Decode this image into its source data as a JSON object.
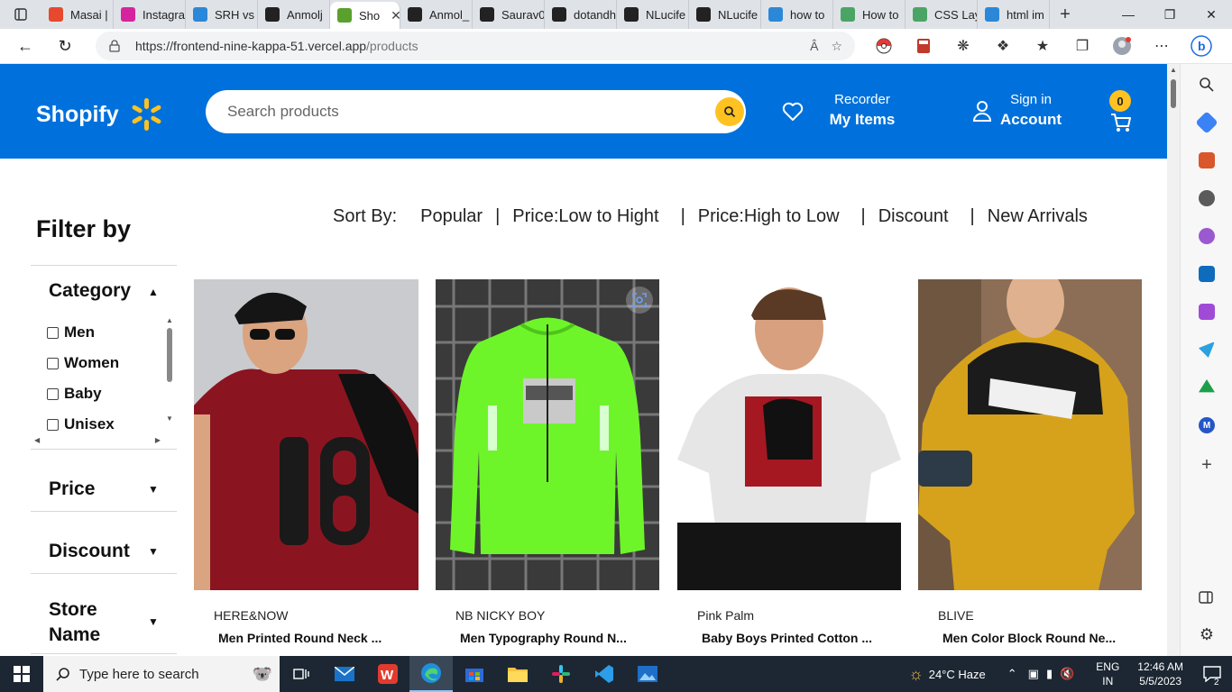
{
  "browser": {
    "tabs": [
      {
        "label": "Masai |",
        "color": "#e6492d"
      },
      {
        "label": "Instagra",
        "color": "#d6249f"
      },
      {
        "label": "SRH vs",
        "color": "#2b88d8"
      },
      {
        "label": "Anmolj",
        "color": "#222222"
      },
      {
        "label": "Sho",
        "color": "#5aa02c",
        "active": true
      },
      {
        "label": "Anmol_",
        "color": "#222222"
      },
      {
        "label": "Saurav0",
        "color": "#222222"
      },
      {
        "label": "dotandh",
        "color": "#222222"
      },
      {
        "label": "NLucife",
        "color": "#222222"
      },
      {
        "label": "NLucife",
        "color": "#222222"
      },
      {
        "label": "how to",
        "color": "#2b88d8"
      },
      {
        "label": "How to",
        "color": "#4aa564"
      },
      {
        "label": "CSS Lay",
        "color": "#4aa564"
      },
      {
        "label": "html im",
        "color": "#2b88d8"
      }
    ],
    "url_host": "https://frontend-nine-kappa-51.vercel.app",
    "url_path": "/products"
  },
  "site": {
    "logo": "Shopify",
    "search_placeholder": "Search products",
    "reorder_small": "Recorder",
    "reorder_big": "My Items",
    "signin_small": "Sign in",
    "signin_big": "Account",
    "cart_count": "0",
    "accent": "#0071dc",
    "yellow": "#ffc220"
  },
  "sort": {
    "label": "Sort By:",
    "options": [
      "Popular",
      "Price:Low to Hight",
      "Price:High to Low",
      "Discount",
      "New Arrivals"
    ]
  },
  "filter": {
    "title": "Filter by",
    "sections": [
      "Category",
      "Price",
      "Discount",
      "Store Name"
    ],
    "categories": [
      "Men",
      "Women",
      "Baby",
      "Unisex"
    ]
  },
  "products": [
    {
      "brand": "HERE&NOW",
      "name": "Men Printed Round Neck ..."
    },
    {
      "brand": "NB NICKY BOY",
      "name": "Men Typography Round N..."
    },
    {
      "brand": "Pink Palm",
      "name": "Baby Boys Printed Cotton ..."
    },
    {
      "brand": "BLIVE",
      "name": "Men Color Block Round Ne..."
    }
  ],
  "taskbar": {
    "search_placeholder": "Type here to search",
    "weather": "24°C  Haze",
    "lang1": "ENG",
    "lang2": "IN",
    "time": "12:46 AM",
    "date": "5/5/2023",
    "notif": "2"
  }
}
